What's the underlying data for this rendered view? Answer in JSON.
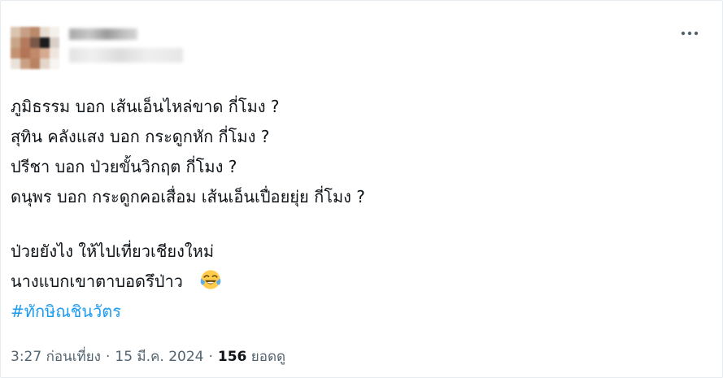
{
  "tweet": {
    "lines": [
      "ภูมิธรรม บอก เส้นเอ็นไหล่ขาด กี่โมง ?",
      "สุทิน คลังแสง บอก กระดูกหัก กี่โมง ?",
      "ปรีชา บอก ป่วยขั้นวิกฤต กี่โมง ?",
      "ดนุพร บอก กระดูกคอเสื่อม เส้นเอ็นเปื่อยยุ่ย กี่โมง ?",
      "ป่วยยังไง ให้ไปเที่ยวเชียงใหม่",
      "นางแบกเขาตาบอดรึป่าว"
    ],
    "emoji": "face-with-tears-of-joy-icon",
    "hashtag": "#ทักษิณชินวัตร"
  },
  "meta": {
    "time": "3:27 ก่อนเที่ยง",
    "separator": "·",
    "date": "15 มี.ค. 2024",
    "views_count": "156",
    "views_label": "ยอดดู"
  },
  "icons": {
    "more": "more-horizontal-icon",
    "avatar": "avatar"
  },
  "colors": {
    "text": "#0f1419",
    "secondary": "#536471",
    "link": "#1d9bf0",
    "border": "#e6ecf0"
  }
}
